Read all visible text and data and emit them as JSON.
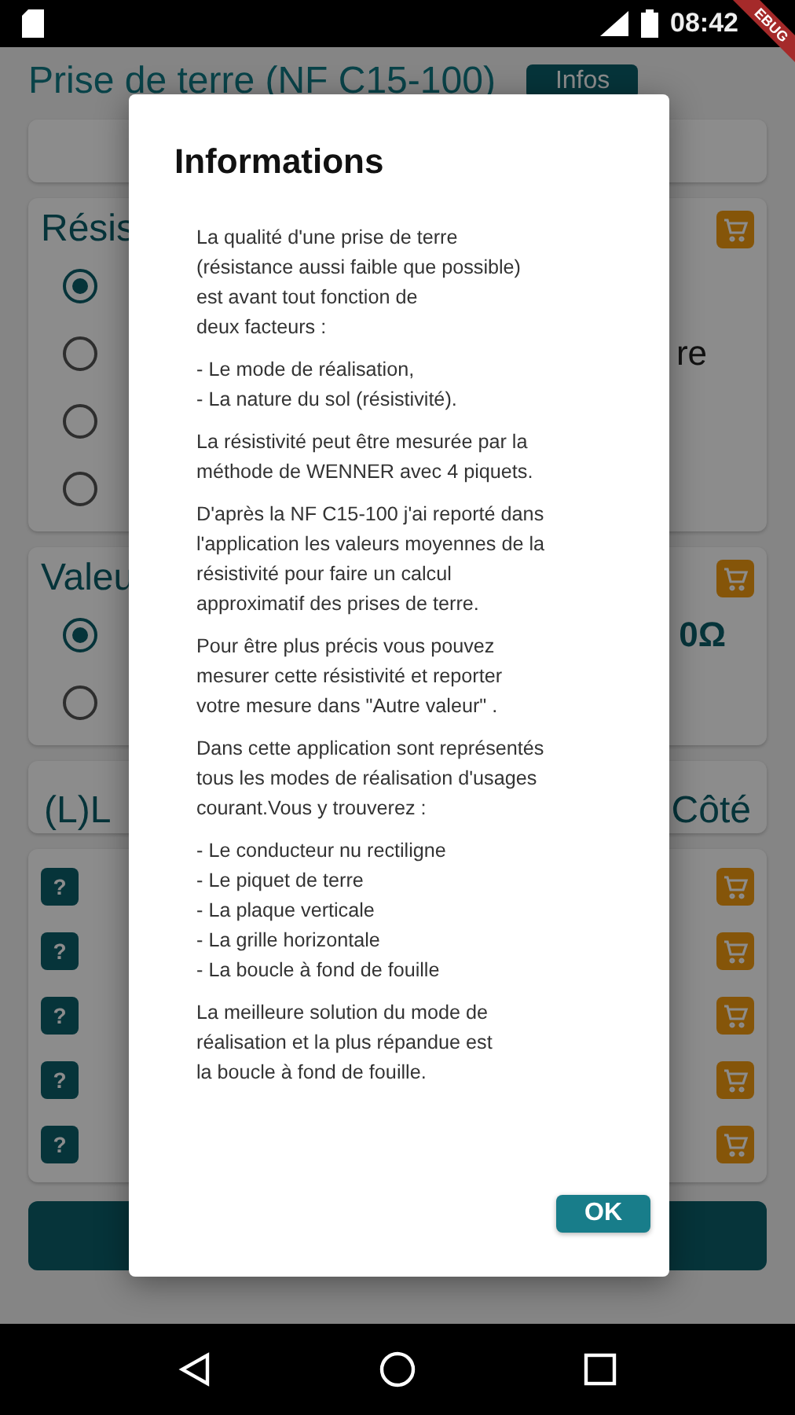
{
  "status_bar": {
    "time": "08:42"
  },
  "debug_banner": "EBUG",
  "background": {
    "title": "Prise de terre (NF C15-100)",
    "info_button": "Infos",
    "resistance": {
      "title": "Résis",
      "options": [
        {
          "selected": true
        },
        {
          "selected": false,
          "label": "re"
        },
        {
          "selected": false
        },
        {
          "selected": false
        }
      ]
    },
    "value": {
      "title": "Valeu",
      "options": [
        {
          "selected": true,
          "label": "0Ω"
        },
        {
          "selected": false
        }
      ]
    },
    "header": {
      "left": "(L)L",
      "right": "Côté"
    },
    "rows": [
      {
        "help": "?"
      },
      {
        "help": "?"
      },
      {
        "help": "?"
      },
      {
        "help": "?"
      },
      {
        "help": "?"
      }
    ]
  },
  "dialog": {
    "title": "Informations",
    "paragraphs": [
      "La qualité d'une prise de terre\n(résistance aussi faible que possible)\nest avant tout fonction de\ndeux facteurs :",
      "- Le mode de réalisation,\n- La nature du sol (résistivité).",
      "La résistivité peut être mesurée par la\nméthode de WENNER avec 4 piquets.",
      "D'après la NF C15-100 j'ai reporté dans\nl'application les valeurs moyennes de la\nrésistivité pour faire un calcul\napproximatif des prises de terre.",
      "Pour être plus précis vous pouvez\nmesurer cette résistivité et reporter\nvotre mesure dans \"Autre valeur\" .",
      "Dans cette application sont représentés\ntous les modes de réalisation d'usages\ncourant.Vous y trouverez :",
      "- Le conducteur nu rectiligne\n- Le piquet de terre\n- La plaque verticale\n- La grille horizontale\n- La boucle à fond de fouille",
      "La meilleure solution du mode de\nréalisation et la plus répandue est\nla boucle à fond de fouille."
    ],
    "ok_button": "OK"
  }
}
